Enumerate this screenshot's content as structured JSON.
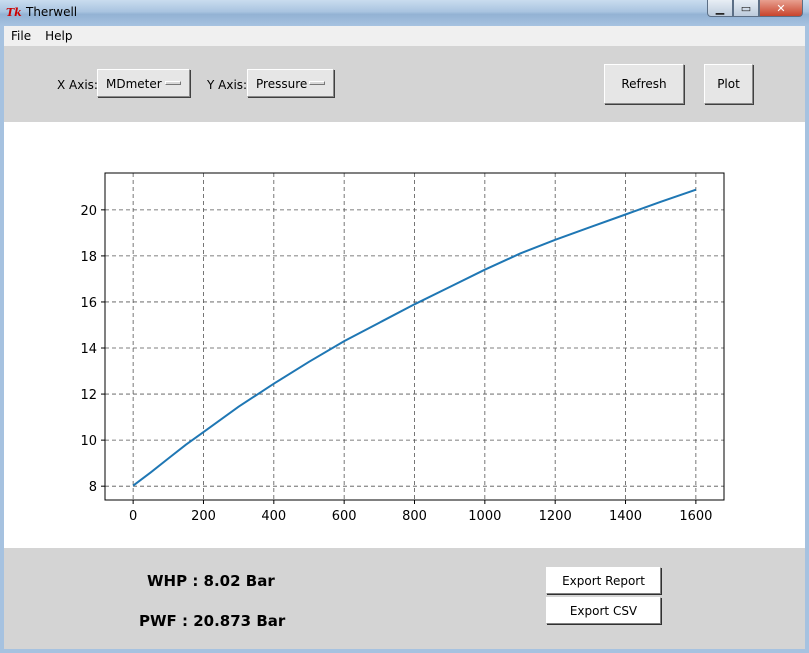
{
  "window": {
    "title": "Therwell"
  },
  "menu": [
    "File",
    "Help"
  ],
  "toolbar": {
    "x_axis_label": "X Axis:",
    "x_axis_value": "MDmeter",
    "y_axis_label": "Y Axis:",
    "y_axis_value": "Pressure",
    "refresh_label": "Refresh",
    "plot_label": "Plot"
  },
  "results": {
    "whp": "WHP : 8.02 Bar",
    "pwf": "PWF : 20.873 Bar"
  },
  "actions": {
    "export_report": "Export Report",
    "export_csv": "Export CSV"
  },
  "chart_data": {
    "type": "line",
    "title": "",
    "xlabel": "",
    "ylabel": "",
    "xlim": [
      -80,
      1680
    ],
    "ylim": [
      7.4,
      21.6
    ],
    "xticks": [
      0,
      200,
      400,
      600,
      800,
      1000,
      1200,
      1400,
      1600
    ],
    "yticks": [
      8,
      10,
      12,
      14,
      16,
      18,
      20
    ],
    "grid": true,
    "line_color": "#1f77b4",
    "x": [
      0,
      50,
      100,
      150,
      200,
      300,
      400,
      500,
      600,
      700,
      800,
      900,
      1000,
      1100,
      1200,
      1300,
      1400,
      1500,
      1600
    ],
    "y": [
      8.02,
      8.6,
      9.2,
      9.8,
      10.35,
      11.45,
      12.45,
      13.4,
      14.3,
      15.1,
      15.9,
      16.65,
      17.4,
      18.1,
      18.7,
      19.25,
      19.8,
      20.35,
      20.873
    ]
  }
}
